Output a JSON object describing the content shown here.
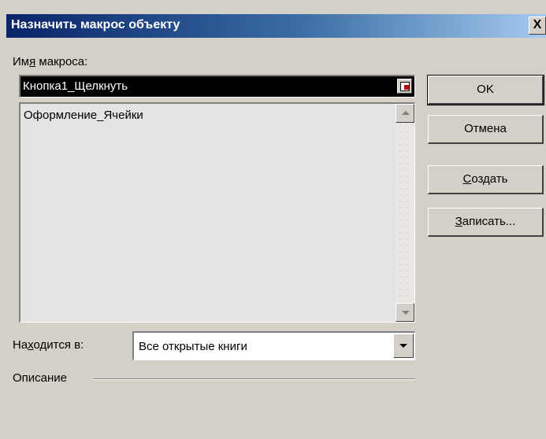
{
  "dialog": {
    "title": "Назначить макрос объекту",
    "close_glyph": "X"
  },
  "macro_name": {
    "label_pre": "Им",
    "label_key": "я",
    "label_post": " макроса:",
    "value": "Кнопка1_Щелкнуть",
    "collapse_icon": "collapse-dialog-icon"
  },
  "macro_list": {
    "items": [
      "Оформление_Ячейки"
    ]
  },
  "location": {
    "label_pre": "На",
    "label_key": "х",
    "label_post": "одится в:",
    "value": "Все открытые книги"
  },
  "description": {
    "label": "Описание"
  },
  "buttons": {
    "ok": "OK",
    "cancel": "Отмена",
    "create_key": "С",
    "create_rest": "оздать",
    "record_key": "З",
    "record_rest": "аписать..."
  }
}
